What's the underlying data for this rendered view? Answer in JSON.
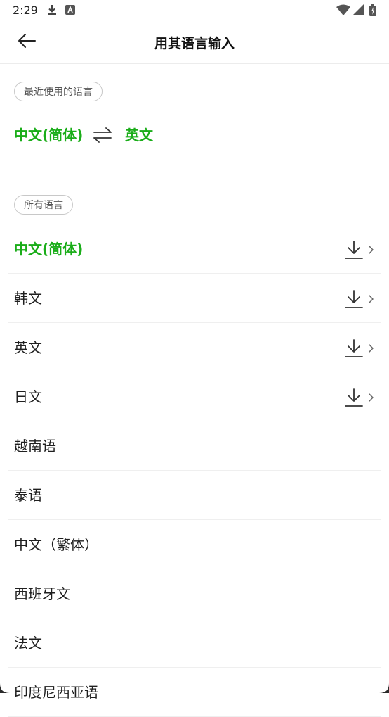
{
  "status_bar": {
    "time": "2:29",
    "icons": [
      "download-icon",
      "text-a-icon",
      "wifi-icon",
      "cell-signal-icon",
      "battery-charging-icon"
    ]
  },
  "header": {
    "back_icon": "arrow-left-icon",
    "title": "用其语言输入"
  },
  "recent": {
    "chip_label": "最近使用的语言",
    "source_language": "中文(简体)",
    "swap_icon": "swap-arrows-icon",
    "target_language": "英文"
  },
  "all_languages": {
    "chip_label": "所有语言",
    "items": [
      {
        "label": "中文(简体)",
        "active": true,
        "downloadable": true
      },
      {
        "label": "韩文",
        "active": false,
        "downloadable": true
      },
      {
        "label": "英文",
        "active": false,
        "downloadable": true
      },
      {
        "label": "日文",
        "active": false,
        "downloadable": true
      },
      {
        "label": "越南语",
        "active": false,
        "downloadable": false
      },
      {
        "label": "泰语",
        "active": false,
        "downloadable": false
      },
      {
        "label": "中文（繁体）",
        "active": false,
        "downloadable": false
      },
      {
        "label": "西班牙文",
        "active": false,
        "downloadable": false
      },
      {
        "label": "法文",
        "active": false,
        "downloadable": false
      },
      {
        "label": "印度尼西亚语",
        "active": false,
        "downloadable": false
      }
    ]
  },
  "colors": {
    "accent": "#1aad19",
    "text": "#1f1f1f",
    "divider": "#efefef"
  }
}
